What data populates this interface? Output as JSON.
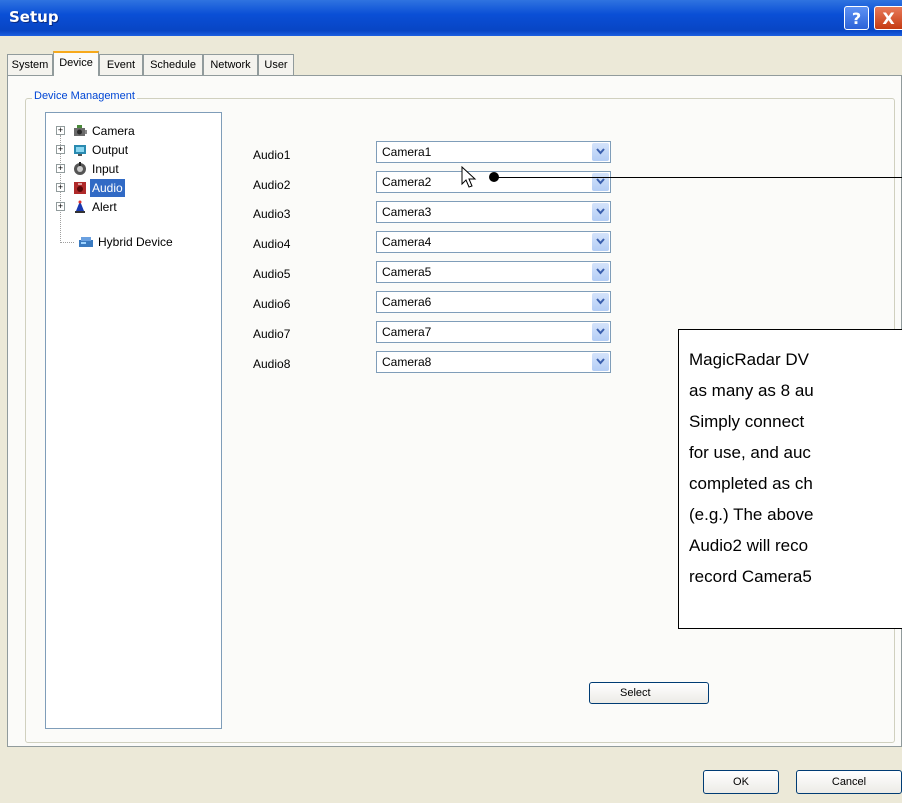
{
  "window": {
    "title": "Setup",
    "help_glyph": "?",
    "close_glyph": "X"
  },
  "tabs": [
    {
      "label": "System"
    },
    {
      "label": "Device"
    },
    {
      "label": "Event"
    },
    {
      "label": "Schedule"
    },
    {
      "label": "Network"
    },
    {
      "label": "User"
    }
  ],
  "active_tab": "Device",
  "group": {
    "label": "Device Management"
  },
  "tree": {
    "items": [
      {
        "label": "Camera",
        "icon": "camera-icon",
        "expander": "+"
      },
      {
        "label": "Output",
        "icon": "output-icon",
        "expander": "+"
      },
      {
        "label": "Input",
        "icon": "input-icon",
        "expander": "+"
      },
      {
        "label": "Audio",
        "icon": "audio-icon",
        "expander": "+"
      },
      {
        "label": "Alert",
        "icon": "alert-icon",
        "expander": "+"
      },
      {
        "label": "Hybrid Device",
        "icon": "hybrid-device-icon",
        "expander": ""
      }
    ],
    "selected": "Audio"
  },
  "audio_rows": [
    {
      "label": "Audio1",
      "value": "Camera1"
    },
    {
      "label": "Audio2",
      "value": "Camera2"
    },
    {
      "label": "Audio3",
      "value": "Camera3"
    },
    {
      "label": "Audio4",
      "value": "Camera4"
    },
    {
      "label": "Audio5",
      "value": "Camera5"
    },
    {
      "label": "Audio6",
      "value": "Camera6"
    },
    {
      "label": "Audio7",
      "value": "Camera7"
    },
    {
      "label": "Audio8",
      "value": "Camera8"
    }
  ],
  "buttons": {
    "select": "Select",
    "ok": "OK",
    "cancel": "Cancel"
  },
  "callout": {
    "lines": [
      "MagicRadar DV",
      "as many as 8 au",
      "Simply connect",
      "for use, and auc",
      "completed as ch",
      "(e.g.) The above",
      "Audio2 will reco",
      "record Camera5"
    ]
  },
  "colors": {
    "title_bar": "#0a4fd6",
    "selection": "#316ac5",
    "active_tab_accent": "#f7a91a",
    "group_label": "#0046d5"
  }
}
